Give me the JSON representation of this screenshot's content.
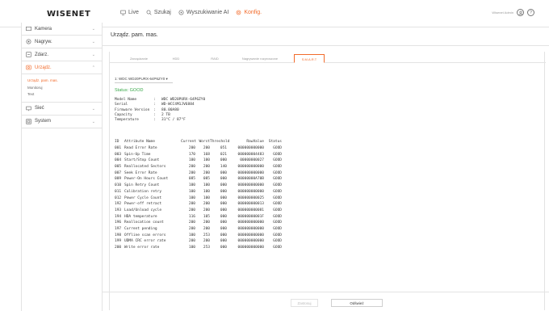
{
  "app": {
    "logo": "WISENET",
    "nav": [
      {
        "label": "Live",
        "icon": "monitor-icon",
        "active": false
      },
      {
        "label": "Szukaj",
        "icon": "search-icon",
        "active": false
      },
      {
        "label": "Wyszukiwanie AI",
        "icon": "ai-search-icon",
        "active": false
      },
      {
        "label": "Konfig.",
        "icon": "gear-icon",
        "active": true
      }
    ],
    "user": "Wisenet Admin"
  },
  "sidebar": {
    "groups": [
      {
        "label": "Kamera",
        "icon": "camera-icon"
      },
      {
        "label": "Nagryw.",
        "icon": "record-icon"
      },
      {
        "label": "Zdarz.",
        "icon": "event-icon"
      },
      {
        "label": "Urządz.",
        "icon": "device-icon"
      }
    ],
    "submenu": [
      "Urządz. pam. mas.",
      "Monitoruj",
      "Text"
    ],
    "groups_after": [
      {
        "label": "Sieć",
        "icon": "network-icon"
      },
      {
        "label": "System",
        "icon": "system-icon"
      }
    ]
  },
  "page": {
    "title": "Urządz. pam. mas.",
    "tabs": [
      "Zarządzanie",
      "HDD",
      "RAID",
      "Nagrywanie rozproszone",
      "S.M.A.R.T"
    ],
    "active_tab": 4,
    "drive_select": "1: WDC WD20PURX-64P6ZY0",
    "status": "Status: GOOD",
    "info": [
      {
        "key": "Model Name",
        "value": "WDC WD20PURX-64P6ZY0"
      },
      {
        "key": "Serial",
        "value": "WD-WCC4M1JV6884"
      },
      {
        "key": "Firmware Version",
        "value": "80.00A80"
      },
      {
        "key": "Capacity",
        "value": "2 TB"
      },
      {
        "key": "Temperature",
        "value": "31°C / 87°F"
      }
    ],
    "smart_headers": [
      "ID",
      "Attribute Name",
      "Current",
      "Worst",
      "Threshold",
      "RawValue",
      "Status"
    ],
    "smart_rows": [
      [
        "001",
        "Read Error Rate",
        "200",
        "200",
        "051",
        "000000000000",
        "GOOD"
      ],
      [
        "003",
        "Spin-Up Time",
        "170",
        "168",
        "021",
        "000000004483",
        "GOOD"
      ],
      [
        "004",
        "Start/Stop Count",
        "100",
        "100",
        "000",
        "00000000027",
        "GOOD"
      ],
      [
        "005",
        "Reallocated Sectors",
        "200",
        "200",
        "140",
        "000000000000",
        "GOOD"
      ],
      [
        "007",
        "Seek Error Rate",
        "200",
        "200",
        "000",
        "000000000000",
        "GOOD"
      ],
      [
        "009",
        "Power-On Hours Count",
        "085",
        "085",
        "000",
        "00000000A70B",
        "GOOD"
      ],
      [
        "010",
        "Spin Retry Count",
        "100",
        "100",
        "000",
        "000000000000",
        "GOOD"
      ],
      [
        "011",
        "Calibration retry",
        "100",
        "100",
        "000",
        "000000000000",
        "GOOD"
      ],
      [
        "012",
        "Power Cycle Count",
        "100",
        "100",
        "000",
        "000000000025",
        "GOOD"
      ],
      [
        "192",
        "Power-off retract",
        "200",
        "200",
        "000",
        "000000000013",
        "GOOD"
      ],
      [
        "193",
        "Load/Unload cycle",
        "200",
        "200",
        "000",
        "000000000081",
        "GOOD"
      ],
      [
        "194",
        "HDA temperature",
        "116",
        "105",
        "000",
        "00000000001F",
        "GOOD"
      ],
      [
        "196",
        "Reallocation count",
        "200",
        "200",
        "000",
        "000000000000",
        "GOOD"
      ],
      [
        "197",
        "Current pending",
        "200",
        "200",
        "000",
        "000000000000",
        "GOOD"
      ],
      [
        "198",
        "Offline scan errors",
        "100",
        "253",
        "000",
        "000000000000",
        "GOOD"
      ],
      [
        "199",
        "UDMA CRC error rate",
        "200",
        "200",
        "000",
        "000000000000",
        "GOOD"
      ],
      [
        "200",
        "Write error rate",
        "100",
        "253",
        "000",
        "000000000000",
        "GOOD"
      ]
    ],
    "apply_label": "Zastosuj",
    "refresh_label": "Odśwież"
  },
  "colors": {
    "accent": "#f26b2b",
    "status_good": "#3aa84a"
  }
}
